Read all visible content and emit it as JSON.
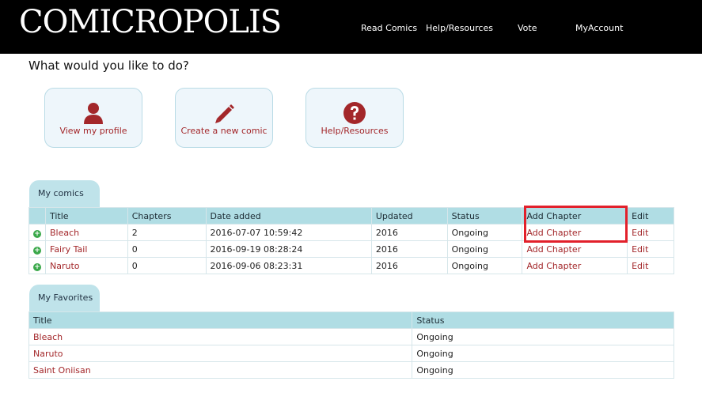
{
  "header": {
    "logo": "COMICROPOLIS",
    "nav": [
      "Read Comics",
      "Help/Resources",
      "Vote",
      "MyAccount"
    ]
  },
  "question": "What would you like to do?",
  "actions": [
    {
      "label": "View my profile",
      "icon": "user-icon"
    },
    {
      "label": "Create a new comic",
      "icon": "pencil-icon"
    },
    {
      "label": "Help/Resources",
      "icon": "question-icon"
    }
  ],
  "my_comics": {
    "tab": "My comics",
    "columns": [
      "Title",
      "Chapters",
      "Date added",
      "Updated",
      "Status",
      "Add Chapter",
      "Edit"
    ],
    "rows": [
      {
        "title": "Bleach",
        "chapters": "2",
        "date_added": "2016-07-07 10:59:42",
        "updated": "2016",
        "status": "Ongoing",
        "add": "Add Chapter",
        "edit": "Edit"
      },
      {
        "title": "Fairy Tail",
        "chapters": "0",
        "date_added": "2016-09-19 08:28:24",
        "updated": "2016",
        "status": "Ongoing",
        "add": "Add Chapter",
        "edit": "Edit"
      },
      {
        "title": "Naruto",
        "chapters": "0",
        "date_added": "2016-09-06 08:23:31",
        "updated": "2016",
        "status": "Ongoing",
        "add": "Add Chapter",
        "edit": "Edit"
      }
    ]
  },
  "my_favorites": {
    "tab": "My Favorites",
    "columns": [
      "Title",
      "Status"
    ],
    "rows": [
      {
        "title": "Bleach",
        "status": "Ongoing"
      },
      {
        "title": "Naruto",
        "status": "Ongoing"
      },
      {
        "title": "Saint Oniisan",
        "status": "Ongoing"
      }
    ]
  },
  "colors": {
    "accent": "#a3272a",
    "table_header": "#b0dde4",
    "highlight": "#e2202b"
  }
}
